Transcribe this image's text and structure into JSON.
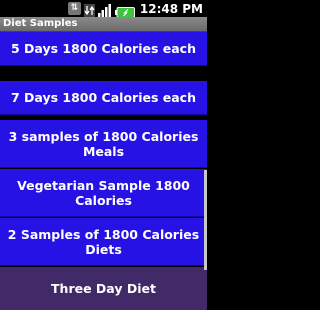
{
  "status": {
    "sync_symbol": "⇅",
    "time": "12:48 PM"
  },
  "window": {
    "title": "Diet Samples"
  },
  "list": {
    "items": [
      {
        "label": "5 Days 1800 Calories each"
      },
      {
        "label": "7 Days 1800 Calories each"
      },
      {
        "label": "3 samples of 1800 Calories Meals"
      },
      {
        "label": "Vegetarian Sample 1800 Calories"
      },
      {
        "label": "2 Samples of 1800 Calories Diets"
      },
      {
        "label": "Three Day Diet"
      }
    ]
  },
  "colors": {
    "item_background": "#2712e6",
    "selected_background": "#412a67",
    "battery_green": "#3cc43c"
  },
  "icons": {
    "sync": "sync-icon",
    "network": "network-icon",
    "signal": "signal-bars-icon",
    "battery": "battery-icon"
  }
}
